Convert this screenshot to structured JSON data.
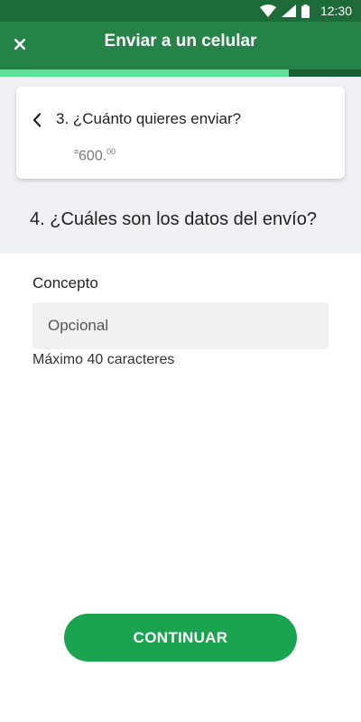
{
  "status_bar": {
    "time": "12:30",
    "icons": [
      "wifi-icon",
      "signal-icon",
      "battery-icon"
    ]
  },
  "header": {
    "title": "Enviar a un celular",
    "close_icon": "close-icon"
  },
  "progress": {
    "fraction": 0.8,
    "fill_color": "#5ee29a",
    "track_color": "#1a5e37"
  },
  "previous_step": {
    "title": "3. ¿Cuánto quieres enviar?",
    "amount_symbol": "¤",
    "amount_integer": "600.",
    "amount_cents": "00",
    "back_icon": "chevron-left-icon"
  },
  "current_step": {
    "title": "4. ¿Cuáles son los datos del envío?"
  },
  "form": {
    "concepto_label": "Concepto",
    "concepto_placeholder": "Opcional",
    "concepto_value": "",
    "hint": "Máximo 40 caracteres"
  },
  "actions": {
    "continue_label": "CONTINUAR"
  },
  "colors": {
    "app_bar": "#268348",
    "status_bar": "#1e6b3a",
    "primary_button": "#1aa44f",
    "section_background": "#f0f1f5"
  }
}
